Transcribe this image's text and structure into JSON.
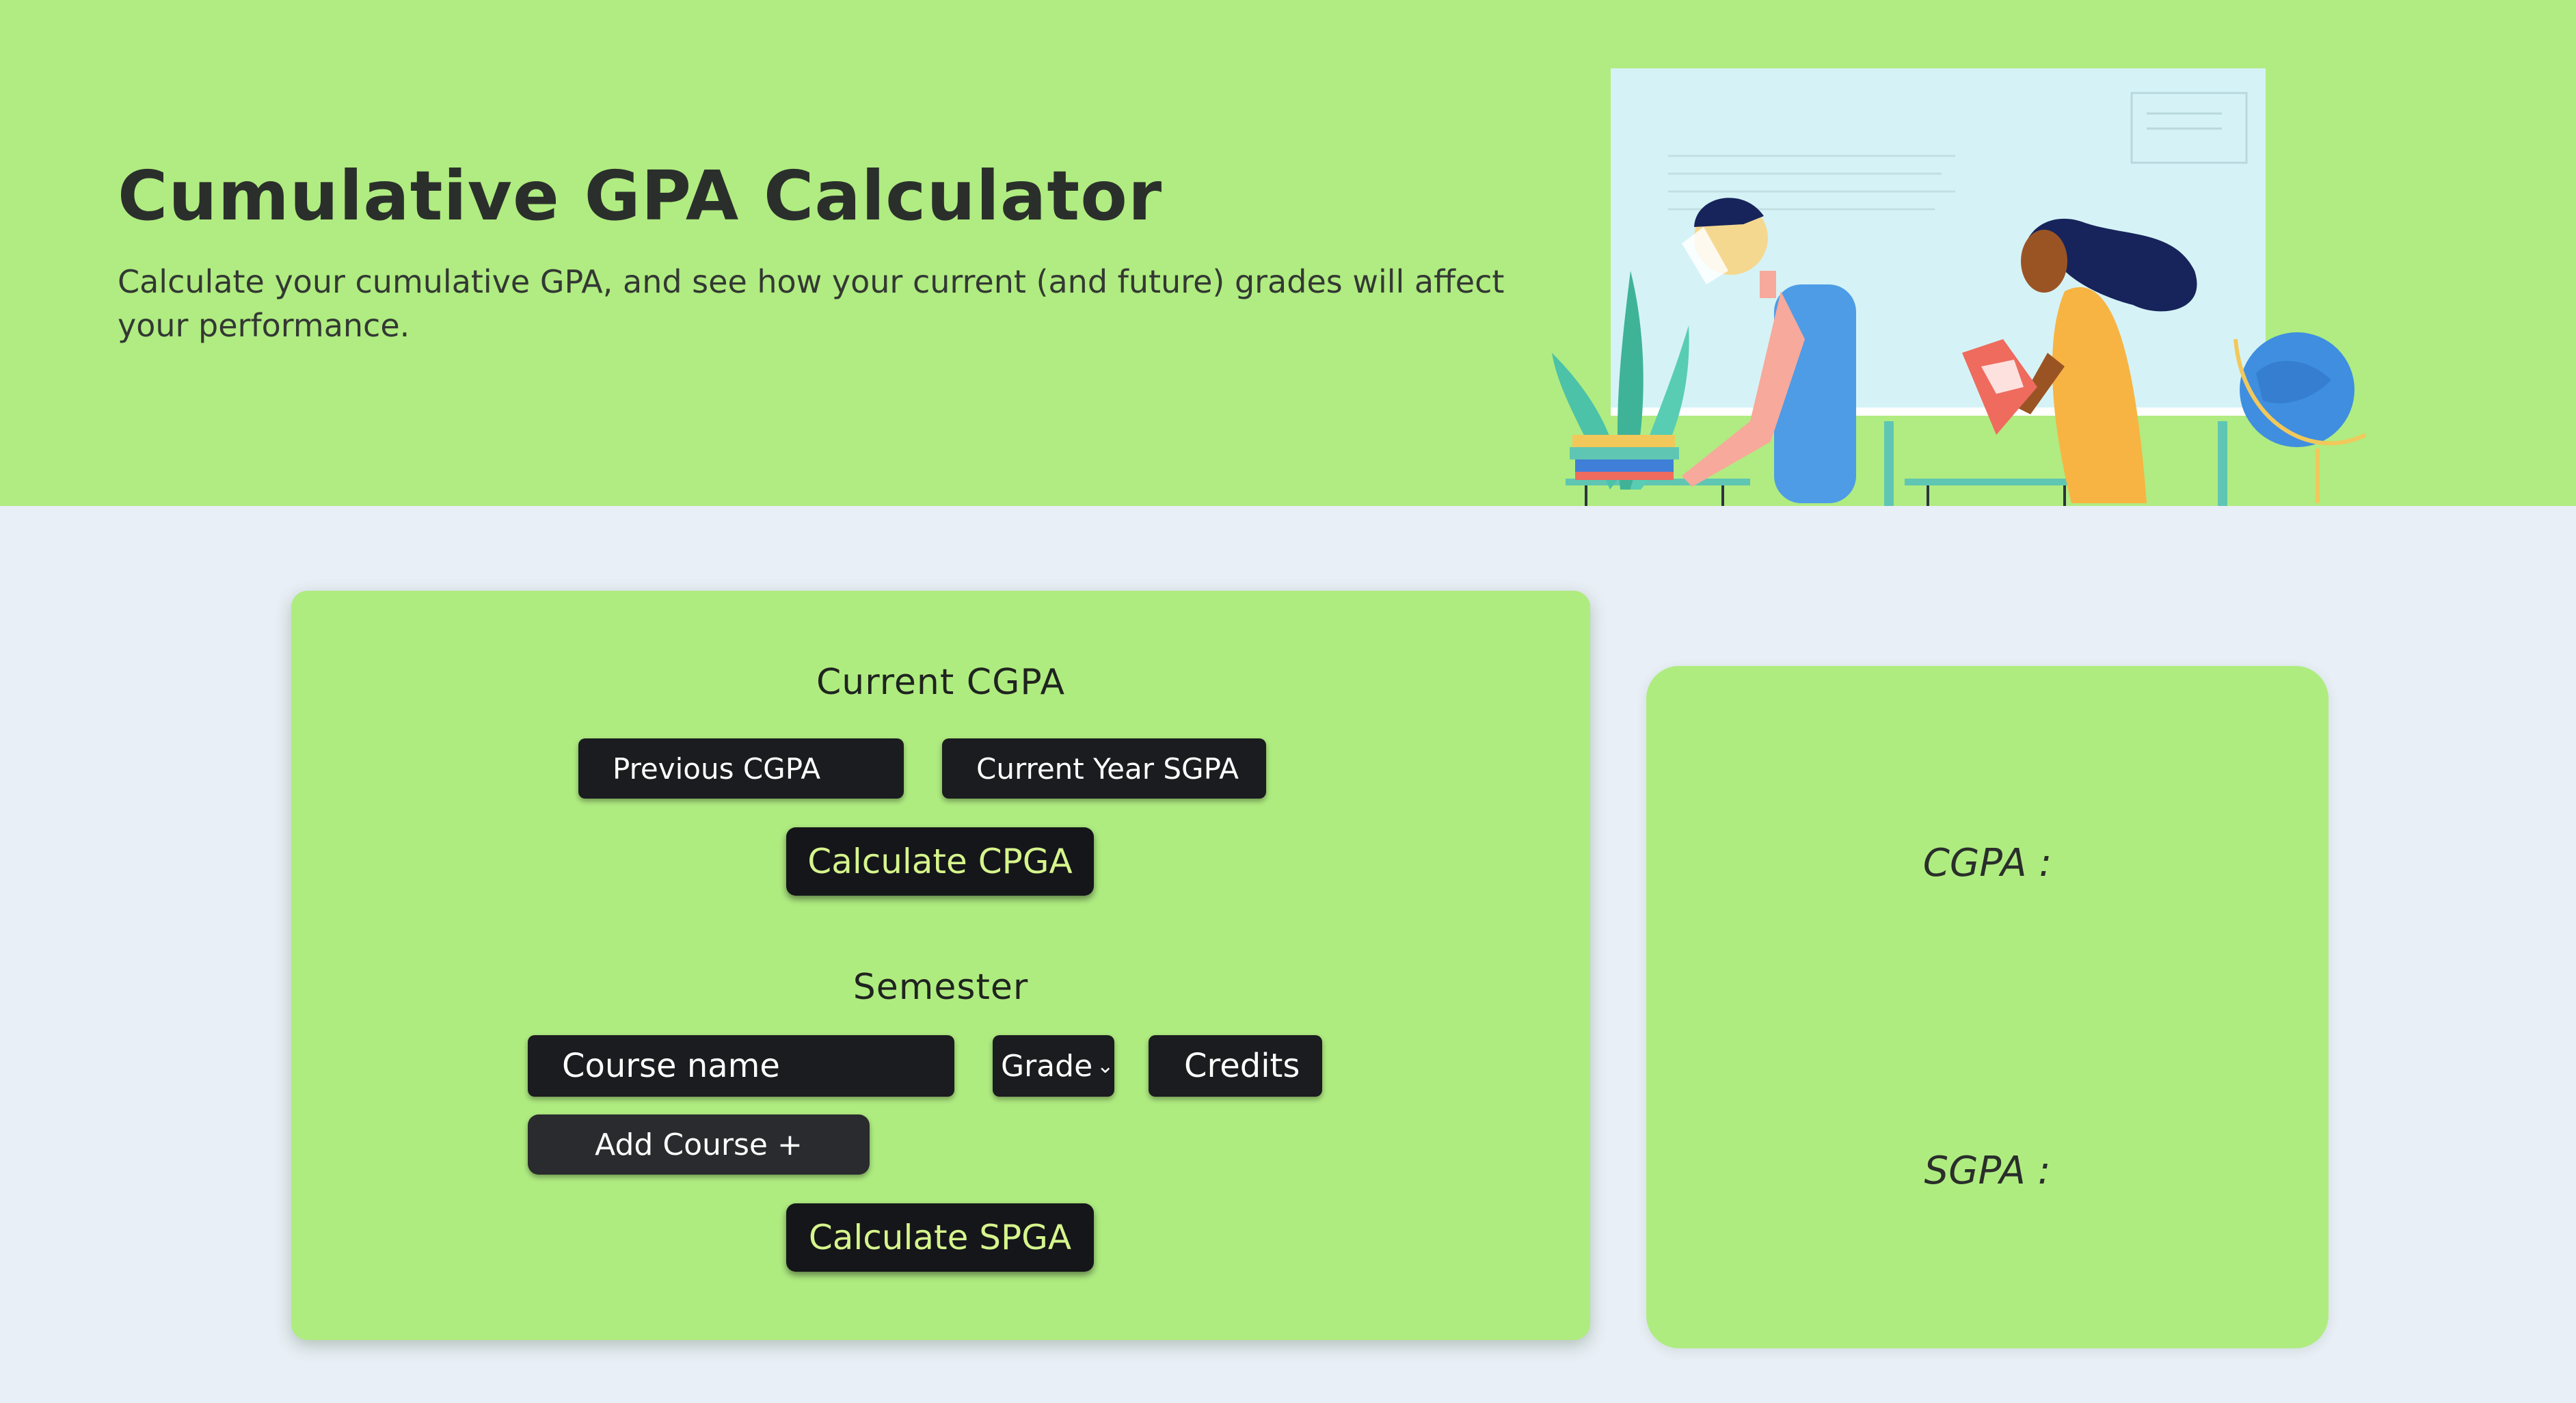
{
  "hero": {
    "title": "Cumulative GPA Calculator",
    "subtitle": "Calculate your cumulative GPA, and see how your current (and future) grades will affect your performance."
  },
  "cgpa_section": {
    "heading": "Current CGPA",
    "previous_cgpa_placeholder": "Previous CGPA",
    "current_sgpa_placeholder": "Current Year SGPA",
    "calculate_button": "Calculate CPGA"
  },
  "semester_section": {
    "heading": "Semester",
    "course_name_placeholder": "Course name",
    "grade_select": "Grade",
    "credits_placeholder": "Credits",
    "add_course_button": "Add Course +",
    "calculate_button": "Calculate SPGA"
  },
  "results": {
    "cgpa_label": "CGPA :",
    "sgpa_label": "SGPA :"
  },
  "colors": {
    "hero_bg": "#b0ec81",
    "card_bg": "#afec80",
    "page_bg": "#e8eff6",
    "button_dark": "#1b1c1f",
    "accent_text": "#d6f58c"
  }
}
